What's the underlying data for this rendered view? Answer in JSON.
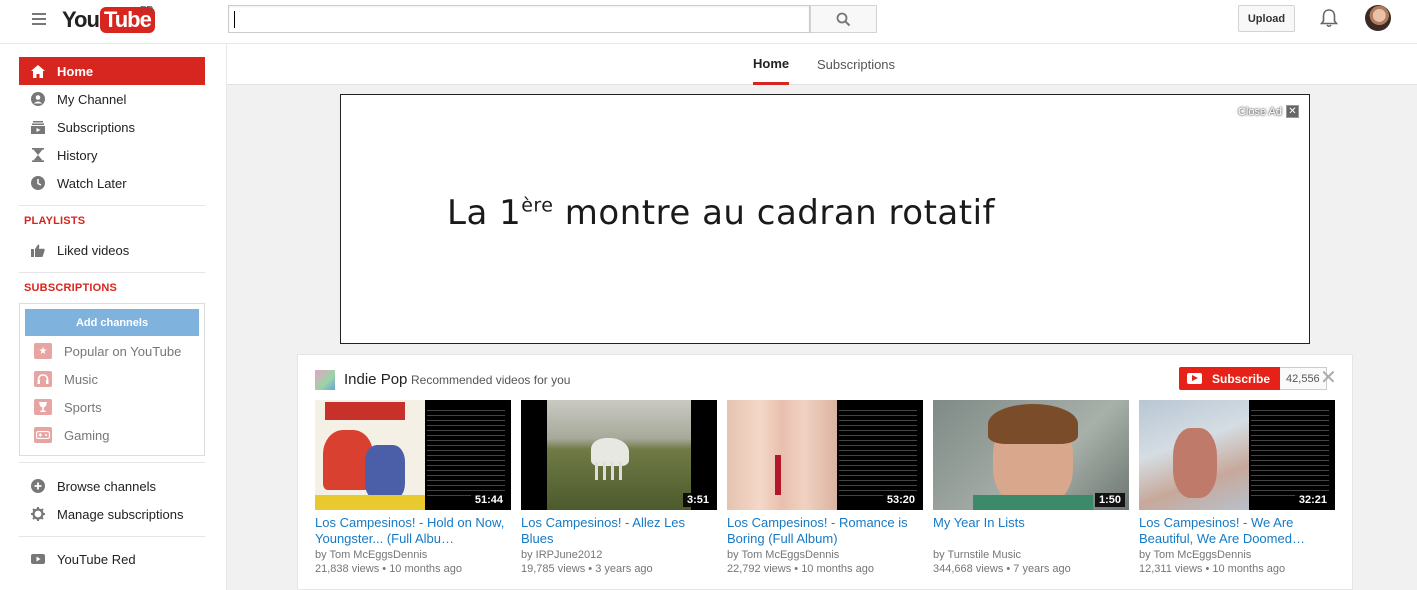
{
  "header": {
    "logo_you": "You",
    "logo_tube": "Tube",
    "region": "FR",
    "search_value": "",
    "upload_label": "Upload"
  },
  "sidebar": {
    "main_items": [
      {
        "label": "Home",
        "icon": "home-icon"
      },
      {
        "label": "My Channel",
        "icon": "person-icon"
      },
      {
        "label": "Subscriptions",
        "icon": "subscriptions-icon"
      },
      {
        "label": "History",
        "icon": "hourglass-icon"
      },
      {
        "label": "Watch Later",
        "icon": "clock-icon"
      }
    ],
    "playlists_header": "PLAYLISTS",
    "playlists": [
      {
        "label": "Liked videos",
        "icon": "thumbs-up-icon"
      }
    ],
    "subscriptions_header": "SUBSCRIPTIONS",
    "add_channels": "Add channels",
    "channels": [
      {
        "label": "Popular on YouTube",
        "icon": "star-icon"
      },
      {
        "label": "Music",
        "icon": "headphones-icon"
      },
      {
        "label": "Sports",
        "icon": "trophy-icon"
      },
      {
        "label": "Gaming",
        "icon": "gamepad-icon"
      }
    ],
    "bottom_items": [
      {
        "label": "Browse channels",
        "icon": "plus-circle-icon"
      },
      {
        "label": "Manage subscriptions",
        "icon": "gear-icon"
      }
    ],
    "red_item": {
      "label": "YouTube Red",
      "icon": "youtube-icon"
    }
  },
  "tabs": [
    {
      "label": "Home"
    },
    {
      "label": "Subscriptions"
    }
  ],
  "ad": {
    "text_before": "La 1",
    "text_sup": "ère",
    "text_after": " montre au cadran rotatif",
    "close_label": "Close Ad"
  },
  "shelf": {
    "title": "Indie Pop",
    "subtitle": "Recommended videos for you",
    "subscribe_label": "Subscribe",
    "subscriber_count": "42,556",
    "videos": [
      {
        "title": "Los Campesinos! - Hold on Now, Youngster... (Full Albu…",
        "channel": "by Tom McEggsDennis",
        "views": "21,838 views",
        "age": "10 months ago",
        "duration": "51:44"
      },
      {
        "title": "Los Campesinos! - Allez Les Blues",
        "channel": "by IRPJune2012",
        "views": "19,785 views",
        "age": "3 years ago",
        "duration": "3:51"
      },
      {
        "title": "Los Campesinos! - Romance is Boring (Full Album)",
        "channel": "by Tom McEggsDennis",
        "views": "22,792 views",
        "age": "10 months ago",
        "duration": "53:20"
      },
      {
        "title": "My Year In Lists",
        "channel": "by Turnstile Music",
        "views": "344,668 views",
        "age": "7 years ago",
        "duration": "1:50"
      },
      {
        "title": "Los Campesinos! - We Are Beautiful, We Are Doomed…",
        "channel": "by Tom McEggsDennis",
        "views": "12,311 views",
        "age": "10 months ago",
        "duration": "32:21"
      }
    ]
  },
  "colors": {
    "brand_red": "#d7261f",
    "link_blue": "#167ac6",
    "add_channels_blue": "#7fb2dd"
  }
}
